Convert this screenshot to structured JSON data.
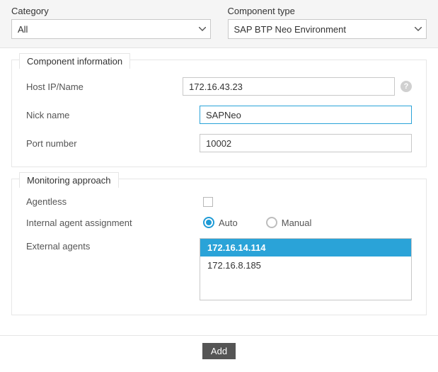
{
  "top": {
    "category": {
      "label": "Category",
      "value": "All"
    },
    "component_type": {
      "label": "Component type",
      "value": "SAP BTP Neo Environment"
    }
  },
  "component_info": {
    "legend": "Component information",
    "host": {
      "label": "Host IP/Name",
      "value": "172.16.43.23"
    },
    "nick": {
      "label": "Nick name",
      "value": "SAPNeo"
    },
    "port": {
      "label": "Port number",
      "value": "10002"
    }
  },
  "monitoring": {
    "legend": "Monitoring approach",
    "agentless": {
      "label": "Agentless",
      "checked": false
    },
    "internal": {
      "label": "Internal agent assignment",
      "selected": "auto",
      "auto_label": "Auto",
      "manual_label": "Manual"
    },
    "external": {
      "label": "External agents",
      "items": [
        "172.16.14.114",
        "172.16.8.185"
      ],
      "selected_index": 0
    }
  },
  "footer": {
    "add": "Add"
  }
}
